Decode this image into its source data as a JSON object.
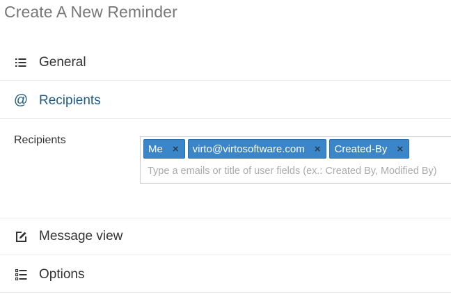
{
  "page": {
    "title": "Create A New Reminder"
  },
  "sections": {
    "general": {
      "label": "General",
      "icon": "list-icon"
    },
    "recipients": {
      "label": "Recipients",
      "icon": "at-icon"
    },
    "message_view": {
      "label": "Message view",
      "icon": "edit-icon"
    },
    "options": {
      "label": "Options",
      "icon": "checklist-icon"
    }
  },
  "recipients_field": {
    "label": "Recipients",
    "tags": [
      {
        "text": "Me",
        "remove": "×"
      },
      {
        "text": "virto@virtosoftware.com",
        "remove": "×"
      },
      {
        "text": "Created-By",
        "remove": "×"
      }
    ],
    "placeholder": "Type a emails or title of user fields (ex.: Created By, Modified By)"
  },
  "colors": {
    "accent": "#1f5b87",
    "tag_bg": "#3a86c8",
    "tag_border": "#2a6fa8"
  }
}
